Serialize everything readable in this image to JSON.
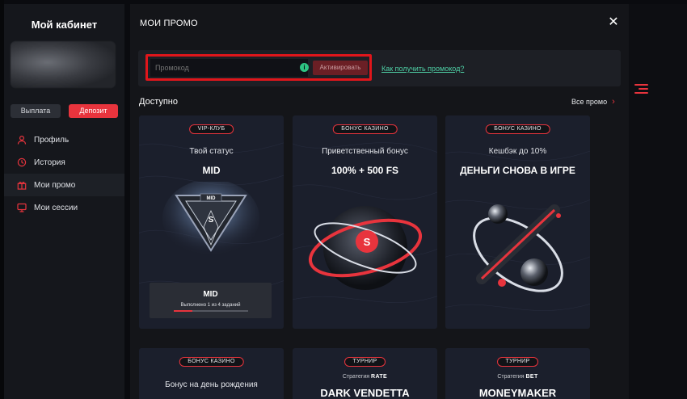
{
  "sidebar": {
    "title": "Мой кабинет",
    "withdraw_label": "Выплата",
    "deposit_label": "Депозит",
    "items": [
      {
        "label": "Профиль",
        "icon": "user-icon"
      },
      {
        "label": "История",
        "icon": "history-icon"
      },
      {
        "label": "Мои промо",
        "icon": "gift-icon"
      },
      {
        "label": "Мои сессии",
        "icon": "sessions-icon"
      }
    ]
  },
  "modal": {
    "title": "МОИ ПРОМО",
    "promo": {
      "placeholder": "Промокод",
      "activate_label": "Активировать",
      "help_link": "Как получить промокод?"
    },
    "available_label": "Доступно",
    "all_promo_label": "Все промо",
    "cards": [
      {
        "badge": "VIP-КЛУБ",
        "subtitle": "Твой статус",
        "headline": "MID",
        "level": "MID",
        "progress_text": "Выполнено 1 из 4 заданий",
        "progress": 0.25
      },
      {
        "badge": "БОНУС КАЗИНО",
        "subtitle": "Приветственный бонус",
        "headline": "100% + 500 FS"
      },
      {
        "badge": "БОНУС КАЗИНО",
        "subtitle": "Кешбэк до 10%",
        "headline": "ДЕНЬГИ СНОВА В ИГРЕ"
      },
      {
        "badge": "БОНУС КАЗИНО",
        "subtitle": "Бонус на день рождения"
      },
      {
        "badge": "ТУРНИР",
        "strategy_prefix": "Стратегия",
        "strategy": "RATE",
        "headline": "DARK VENDETTA"
      },
      {
        "badge": "ТУРНИР",
        "strategy_prefix": "Стратегия",
        "strategy": "BET",
        "headline": "MONEYMAKER"
      }
    ]
  },
  "colors": {
    "accent": "#e8343d",
    "link": "#4fd0a6",
    "card_bg": "#1b1f2c",
    "modal_bg": "#141519"
  }
}
